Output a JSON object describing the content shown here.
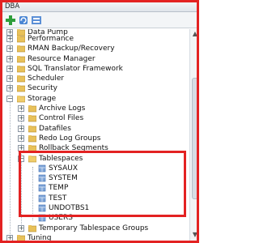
{
  "window": {
    "title": "DBA"
  },
  "tree": {
    "items": [
      {
        "label": "Data Pump"
      },
      {
        "label": "Performance"
      },
      {
        "label": "RMAN Backup/Recovery"
      },
      {
        "label": "Resource Manager"
      },
      {
        "label": "SQL Translator Framework"
      },
      {
        "label": "Scheduler"
      },
      {
        "label": "Security"
      },
      {
        "label": "Storage"
      },
      {
        "label": "Archive Logs"
      },
      {
        "label": "Control Files"
      },
      {
        "label": "Datafiles"
      },
      {
        "label": "Redo Log Groups"
      },
      {
        "label": "Rollback Segments"
      },
      {
        "label": "Tablespaces"
      },
      {
        "label": "SYSAUX"
      },
      {
        "label": "SYSTEM"
      },
      {
        "label": "TEMP"
      },
      {
        "label": "TEST"
      },
      {
        "label": "UNDOTBS1"
      },
      {
        "label": "USERS"
      },
      {
        "label": "Temporary Tablespace Groups"
      },
      {
        "label": "Tuning"
      }
    ]
  },
  "colors": {
    "highlight": "#e32222",
    "folder": "#e8c15a",
    "db": "#e5ad4f",
    "table": "#7fa6d8"
  }
}
